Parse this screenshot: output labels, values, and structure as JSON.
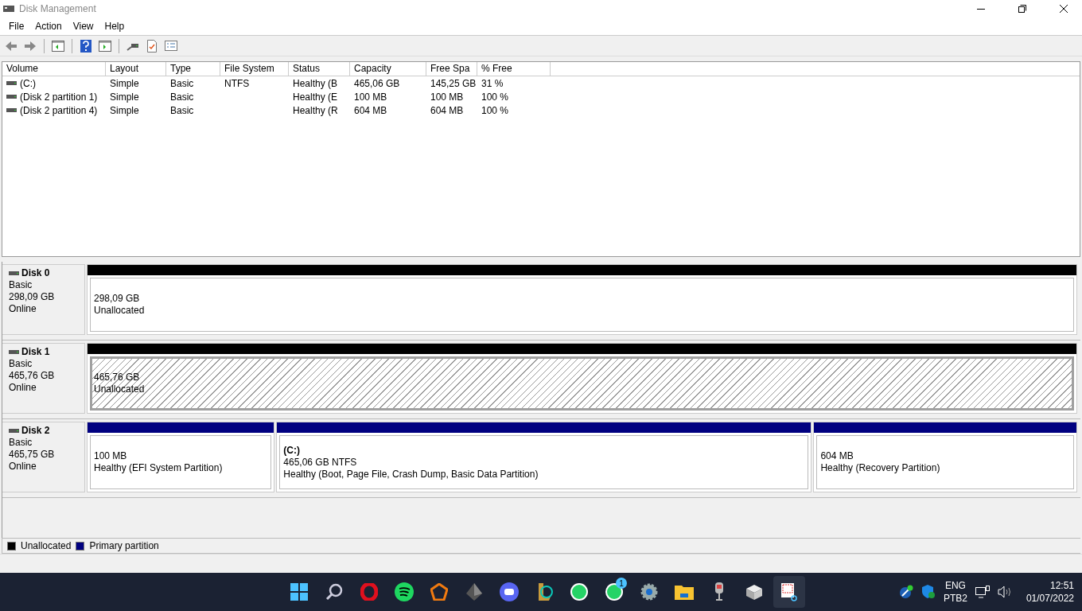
{
  "window": {
    "title": "Disk Management"
  },
  "menu": [
    "File",
    "Action",
    "View",
    "Help"
  ],
  "table": {
    "columns": [
      "Volume",
      "Layout",
      "Type",
      "File System",
      "Status",
      "Capacity",
      "Free Spa",
      "% Free"
    ],
    "rows": [
      {
        "cells": [
          "(C:)",
          "Simple",
          "Basic",
          "NTFS",
          "Healthy (B",
          "465,06 GB",
          "145,25 GB",
          "31 %"
        ]
      },
      {
        "cells": [
          "(Disk 2 partition 1)",
          "Simple",
          "Basic",
          "",
          "Healthy (E",
          "100 MB",
          "100 MB",
          "100 %"
        ]
      },
      {
        "cells": [
          "(Disk 2 partition 4)",
          "Simple",
          "Basic",
          "",
          "Healthy (R",
          "604 MB",
          "604 MB",
          "100 %"
        ]
      }
    ]
  },
  "disks": [
    {
      "name": "Disk 0",
      "type": "Basic",
      "size": "298,09 GB",
      "status": "Online",
      "partitions": [
        {
          "kind": "unallocated",
          "selected": false,
          "size": "298,09 GB",
          "status": "Unallocated"
        }
      ]
    },
    {
      "name": "Disk 1",
      "type": "Basic",
      "size": "465,76 GB",
      "status": "Online",
      "partitions": [
        {
          "kind": "unallocated",
          "selected": true,
          "size": "465,76 GB",
          "status": "Unallocated"
        }
      ]
    },
    {
      "name": "Disk 2",
      "type": "Basic",
      "size": "465,75 GB",
      "status": "Online",
      "partitions": [
        {
          "kind": "primary",
          "selected": false,
          "size": "100 MB",
          "status": "Healthy (EFI System Partition)"
        },
        {
          "kind": "primary",
          "selected": false,
          "label": "(C:)",
          "size": "465,06 GB NTFS",
          "status": "Healthy (Boot, Page File, Crash Dump, Basic Data Partition)"
        },
        {
          "kind": "primary",
          "selected": false,
          "size": "604 MB",
          "status": "Healthy (Recovery Partition)"
        }
      ]
    }
  ],
  "legend": [
    {
      "label": "Unallocated",
      "color": "#000000"
    },
    {
      "label": "Primary partition",
      "color": "#000080"
    }
  ],
  "taskbar": {
    "badge": "1",
    "language": "ENG",
    "layout": "PTB2",
    "time": "12:51",
    "date": "01/07/2022"
  }
}
